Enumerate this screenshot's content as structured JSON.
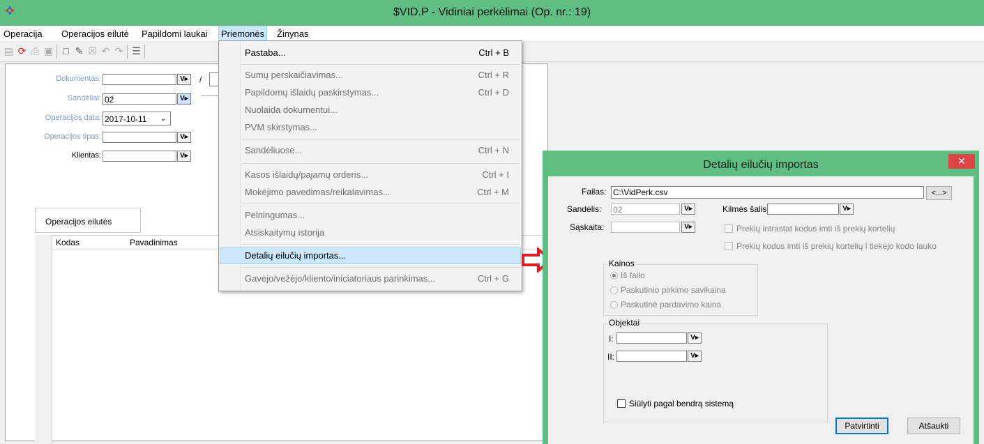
{
  "window": {
    "title": "$VID.P - Vidiniai perkėlimai (Op. nr.: 19)"
  },
  "menubar": [
    "Operacija",
    "Operacijos eilutė",
    "Papildomi laukai",
    "Priemonės",
    "Žinynas"
  ],
  "form": {
    "dokumentas_label": "Dokumentas:",
    "dokumentas_value": "",
    "dokumentas_sep": "/",
    "sandeliai_label": "Sandėliai:",
    "sandeliai_value": "02",
    "sandeliai_dash": "----------",
    "data_label": "Operacijos data:",
    "data_value": "2017-10-11",
    "tipas_label": "Operacijos tipas:",
    "klientas_label": "Klientas:"
  },
  "tab": {
    "label": "Operacijos eilutės"
  },
  "grid": {
    "columns": [
      "Kodas",
      "Pavadinimas"
    ]
  },
  "dropdown": [
    {
      "label": "Pastaba...",
      "shortcut": "Ctrl + B",
      "disabled": false
    },
    {
      "label": "Sumų perskaičiavimas...",
      "shortcut": "Ctrl + R",
      "disabled": true
    },
    {
      "label": "Papildomų išlaidų paskirstymas...",
      "shortcut": "Ctrl + D",
      "disabled": true
    },
    {
      "label": "Nuolaida dokumentui...",
      "shortcut": "",
      "disabled": true
    },
    {
      "label": "PVM skirstymas...",
      "shortcut": "",
      "disabled": true
    },
    {
      "label": "Sandėliuose...",
      "shortcut": "Ctrl + N",
      "disabled": true
    },
    {
      "label": "Kasos išlaidų/pajamų orderis...",
      "shortcut": "Ctrl + I",
      "disabled": true
    },
    {
      "label": "Mokėjimo pavedimas/reikalavimas...",
      "shortcut": "Ctrl + M",
      "disabled": true
    },
    {
      "label": "Pelningumas...",
      "shortcut": "",
      "disabled": true
    },
    {
      "label": "Atsiskaitymų istorija",
      "shortcut": "",
      "disabled": true
    },
    {
      "label": "Detalių eilučių importas...",
      "shortcut": "",
      "disabled": false
    },
    {
      "label": "Gavėjo/vežėjo/kliento/iniciatoriaus parinkimas...",
      "shortcut": "Ctrl + G",
      "disabled": true
    }
  ],
  "dialog": {
    "title": "Detalių eilučių importas",
    "failas_label": "Failas:",
    "failas_value": "C:\\VidPerk.csv",
    "browse_label": "<...>",
    "sandelis_label": "Sandėlis:",
    "sandelis_value": "02",
    "kilmes_label": "Kilmės šalis:",
    "saskaita_label": "Sąskaita:",
    "chk_intrastat": "Prekių intrastat kodus imti iš prekių kortelių",
    "chk_kodus": "Prekių kodus imti iš prekių kortelių l tiekėjo kodo lauko",
    "kainos_title": "Kainos",
    "kainos_options": [
      "Iš failo",
      "Paskutinio pirkimo savikaina",
      "Paskutinė pardavimo kaina"
    ],
    "objektai_title": "Objektai",
    "obj_i_label": "I:",
    "obj_ii_label": "II:",
    "siulyti_label": "Siūlyti pagal bendrą sistemą",
    "ok_label": "Patvirtinti",
    "cancel_label": "Atšaukti"
  },
  "colors": {
    "titlebar": "#5fbf82",
    "highlight": "#cce8ff",
    "close": "#e04343",
    "arrow": "#e02020"
  }
}
